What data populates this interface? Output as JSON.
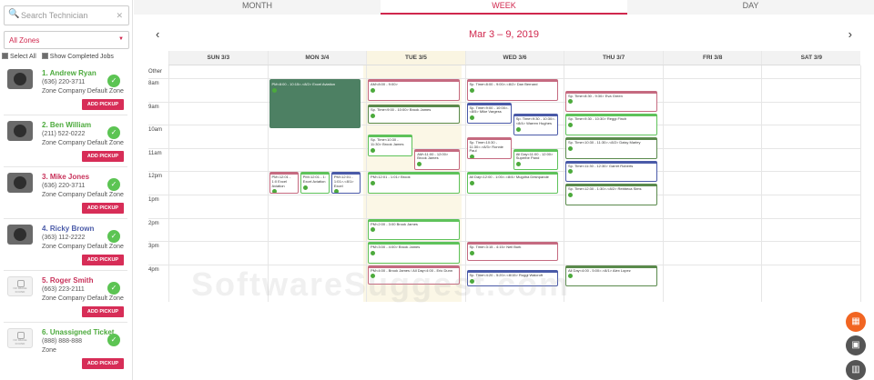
{
  "search": {
    "placeholder": "Search Technician"
  },
  "zones": {
    "selected": "All Zones"
  },
  "filters": {
    "select_all": "Select All",
    "show_completed": "Show Completed Jobs"
  },
  "technicians": [
    {
      "name": "1. Andrew Ryan",
      "phone": "(636) 220-3711",
      "zone": "Zone Company Default Zone",
      "button": "ADD PICKUP",
      "name_color": "green"
    },
    {
      "name": "2. Ben William",
      "phone": "(211) 522-0222",
      "zone": "Zone Company Default Zone",
      "button": "ADD PICKUP",
      "name_color": "green"
    },
    {
      "name": "3. Mike Jones",
      "phone": "(636) 220-3711",
      "zone": "Zone Company Default Zone",
      "button": "ADD PICKUP",
      "name_color": "red"
    },
    {
      "name": "4. Ricky Brown",
      "phone": "(363) 112-2222",
      "zone": "Zone Company Default Zone",
      "button": "ADD PICKUP",
      "name_color": "blue"
    },
    {
      "name": "5. Roger Smith",
      "phone": "(663) 223-2111",
      "zone": "Zone Company Default Zone",
      "button": "ADD PICKUP",
      "name_color": "red"
    },
    {
      "name": "6. Unassigned Ticket",
      "phone": "(888) 888-888",
      "zone": "Zone",
      "button": "ADD PICKUP",
      "name_color": "green"
    }
  ],
  "no_image_label": "NO IMAGE FOUND",
  "tabs": [
    {
      "label": "MONTH",
      "active": false
    },
    {
      "label": "WEEK",
      "active": true
    },
    {
      "label": "DAY",
      "active": false
    }
  ],
  "calendar": {
    "range_title": "Mar 3 – 9, 2019",
    "days": [
      "SUN 3/3",
      "MON 3/4",
      "TUE 3/5",
      "WED 3/6",
      "THU 3/7",
      "FRI 3/8",
      "SAT 3/9"
    ],
    "hours": [
      "Other",
      "8am",
      "9am",
      "10am",
      "11am",
      "12pm",
      "1pm",
      "2pm",
      "3pm",
      "4pm"
    ],
    "events": [
      {
        "day": 1,
        "start": 8.0,
        "end": 10.2,
        "text": "PM<8:00 - 10:15>-<8/2> Excel Aviation",
        "color": "fill"
      },
      {
        "day": 1,
        "start": 12.0,
        "end": 13.0,
        "text": "PM<12:01 - 1:0 Excel Aviation",
        "color": "pink"
      },
      {
        "day": 1,
        "start": 12.0,
        "end": 13.0,
        "text": "PM<12:01 - 1: Excel Aviation",
        "color": "green"
      },
      {
        "day": 1,
        "start": 12.0,
        "end": 13.0,
        "text": "PM<12:01 - 1:01>-<8/1> Excel",
        "color": "blue"
      },
      {
        "day": 2,
        "start": 8.0,
        "end": 9.0,
        "text": "AM<8:00 - 9:00>",
        "color": "pink"
      },
      {
        "day": 2,
        "start": 9.1,
        "end": 10.0,
        "text": "Sp. Time<9:00 - 10:00> Brook James",
        "color": "darkg"
      },
      {
        "day": 2,
        "start": 10.4,
        "end": 11.4,
        "text": "Sp. Time<10:30 - 11:30> Brook James",
        "color": "green"
      },
      {
        "day": 2,
        "start": 11.0,
        "end": 12.0,
        "text": "AM<11:00 - 12:00> Brook James",
        "color": "pink"
      },
      {
        "day": 2,
        "start": 12.0,
        "end": 13.0,
        "text": "PM<12:01 - 1:01> Brook",
        "color": "green"
      },
      {
        "day": 2,
        "start": 14.0,
        "end": 15.0,
        "text": "PM<2:00 - 3:00 Brook James",
        "color": "green"
      },
      {
        "day": 2,
        "start": 15.0,
        "end": 16.0,
        "text": "PM<3:00 - 4:00> Brook James",
        "color": "green"
      },
      {
        "day": 2,
        "start": 16.0,
        "end": 16.9,
        "text": "PM<4:00 - Brook James / All Day<4:00 - Eric Dunn",
        "color": "pink"
      },
      {
        "day": 3,
        "start": 8.0,
        "end": 9.0,
        "text": "Sp. Time<8:00 - 9:00>-<8/2> Dan Bernard",
        "color": "pink"
      },
      {
        "day": 3,
        "start": 9.0,
        "end": 10.0,
        "text": "Sp. Time<9:00 - 10:00>-<8/5> Mike Vargess",
        "color": "blue"
      },
      {
        "day": 3,
        "start": 9.5,
        "end": 10.5,
        "text": "Sp. Time<9:30 - 10:30>-<8/4> Warren Hughes",
        "color": "blue"
      },
      {
        "day": 3,
        "start": 10.5,
        "end": 11.5,
        "text": "Sp. Time<10:30 - 11:30>-<8/3> Ronnie Paul",
        "color": "pink"
      },
      {
        "day": 3,
        "start": 11.0,
        "end": 12.0,
        "text": "All Day<11:00 - 12:00> Superbe Pand",
        "color": "green"
      },
      {
        "day": 3,
        "start": 12.0,
        "end": 13.0,
        "text": "All Day<12:00 - 1:00>-<8/4> Mugdha Deshpande",
        "color": "green"
      },
      {
        "day": 3,
        "start": 15.0,
        "end": 15.9,
        "text": "Sp. Time<3:15 - 4:15> Neil Burk",
        "color": "pink"
      },
      {
        "day": 3,
        "start": 16.2,
        "end": 17.0,
        "text": "Sp. Time<4:20 - 5:20>-<8/15> Roggi Walcroft",
        "color": "blue"
      },
      {
        "day": 4,
        "start": 8.5,
        "end": 9.5,
        "text": "Sp. Time<8:30 - 9:30> Eva Green",
        "color": "pink"
      },
      {
        "day": 4,
        "start": 9.5,
        "end": 10.5,
        "text": "Sp. Time<9:30 - 10:30> Reggi Finch",
        "color": "green"
      },
      {
        "day": 4,
        "start": 10.5,
        "end": 11.5,
        "text": "Sp. Time<10:30 - 11:30>-<8/2> Daisy Marley",
        "color": "darkg"
      },
      {
        "day": 4,
        "start": 11.5,
        "end": 12.5,
        "text": "Sp. Time<11:30 - 12:30> Garret Roberts",
        "color": "blue"
      },
      {
        "day": 4,
        "start": 12.5,
        "end": 13.5,
        "text": "Sp. Time<12:30 - 1:30>-<8/2> Rebbeca Sims",
        "color": "darkg"
      },
      {
        "day": 4,
        "start": 16.0,
        "end": 17.0,
        "text": "All Day<4:00 - 5:00>-<8/1> Alex Lopez",
        "color": "darkg"
      }
    ]
  },
  "watermark": "SoftwareSuggest.com",
  "fabs": [
    {
      "icon": "calendar-icon",
      "glyph": "▦"
    },
    {
      "icon": "map-icon",
      "glyph": "▣"
    },
    {
      "icon": "chart-icon",
      "glyph": "▥"
    }
  ]
}
